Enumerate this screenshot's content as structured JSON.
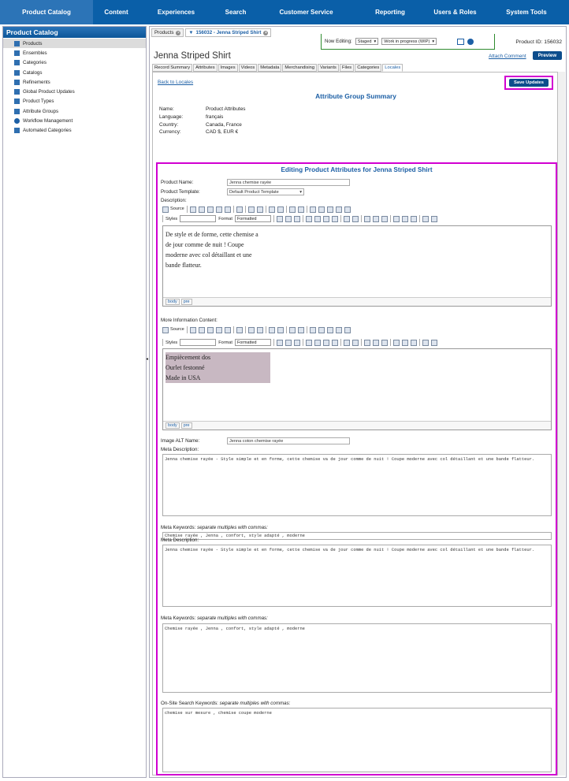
{
  "nav": {
    "items": [
      "Product Catalog",
      "Content",
      "Experiences",
      "Search",
      "Customer Service",
      "Reporting",
      "Users & Roles",
      "System Tools"
    ],
    "active": 0
  },
  "sidebar": {
    "title": "Product Catalog",
    "items": [
      "Products",
      "Ensembles",
      "Categories",
      "Catalogs",
      "Refinements",
      "Global Product Updates",
      "Product Types",
      "Attribute Groups",
      "Workflow Management",
      "Automated Categories"
    ],
    "active": 0
  },
  "tabs": {
    "products": "Products",
    "record": "156032 - Jenna Striped Shirt"
  },
  "editing": {
    "label": "Now Editing:",
    "stage": "Staged",
    "status": "Work in progress (WIP)"
  },
  "product": {
    "id_label": "Product ID: 156032",
    "title": "Jenna Striped Shirt",
    "attach": "Attach Comment",
    "preview": "Preview"
  },
  "subtabs": [
    "Record Summary",
    "Attributes",
    "Images",
    "Videos",
    "Metadata",
    "Merchandising",
    "Variants",
    "Files",
    "Categories",
    "Locales"
  ],
  "locale": {
    "back": "Back to Locales",
    "save": "Save Updates",
    "summary_title": "Attribute Group Summary",
    "rows": [
      {
        "k": "Name:",
        "v": "Product Attributes"
      },
      {
        "k": "Language:",
        "v": "français"
      },
      {
        "k": "Country:",
        "v": "Canada, France"
      },
      {
        "k": "Currency:",
        "v": "CAD $, EUR €"
      }
    ]
  },
  "form": {
    "title": "Editing Product Attributes for Jenna Striped Shirt",
    "product_name_label": "Product Name:",
    "product_name": "Jenna chemise rayée",
    "template_label": "Product Template:",
    "template": "Default Product Template",
    "description_label": "Description:",
    "description_lines": [
      "De style et de forme, cette chemise a",
      "de jour comme de nuit ! Coupe",
      "moderne avec col détaillant et une",
      "bande flatteur."
    ],
    "more_info_label": "More Information Content:",
    "more_info_lines": [
      "Empiècement dos",
      "Ourlet festonné",
      "Made in USA"
    ],
    "path_body": "body",
    "path_pre": "pre",
    "tb_source": "Source",
    "tb_styles": "Styles",
    "tb_format": "Format",
    "tb_formatted": "Formatted",
    "alt_label": "Image ALT Name:",
    "alt_value": "Jenna coton chemise rayée",
    "meta_desc_label": "Meta Description:",
    "meta_desc": "Jenna chemise rayée - Style simple et en forme, cette chemise va de jour comme de nuit ! Coupe moderne avec col détaillant et une bande flatteur.",
    "meta_kw_label": "Meta Keywords:",
    "meta_kw_hint": "separate multiples with commas:",
    "meta_kw": "Chemise rayée , Jenna , confort, style adapté , moderne",
    "onsite_label": "On-Site Search Keywords:",
    "onsite_hint": "separate multiples with commas:",
    "onsite": "chemise sur mesure , chemise coupe moderne"
  }
}
